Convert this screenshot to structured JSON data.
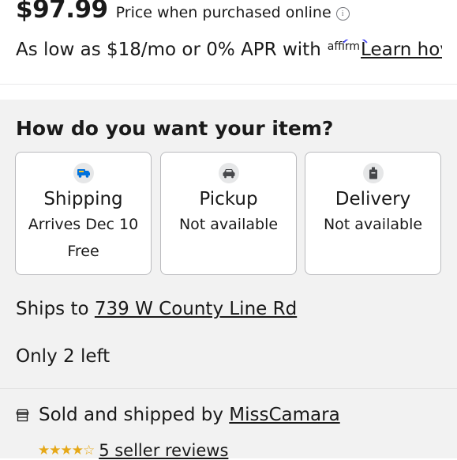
{
  "product": {
    "price": "$97.99",
    "price_note": "Price when purchased online",
    "info_glyph": "i"
  },
  "financing": {
    "text": "As low as $18/mo or 0% APR with",
    "brand": "affirm",
    "link": "Learn hov"
  },
  "fulfillment": {
    "question": "How do you want your item?",
    "options": [
      {
        "title": "Shipping",
        "subtitle": "Arrives Dec 10",
        "extra": "Free",
        "icon": "shipping-truck-icon"
      },
      {
        "title": "Pickup",
        "subtitle": "Not available",
        "icon": "pickup-car-icon"
      },
      {
        "title": "Delivery",
        "subtitle": "Not available",
        "icon": "delivery-bag-icon"
      }
    ]
  },
  "shipping": {
    "ships_to_label": "Ships to",
    "address": "739 W County Line Rd"
  },
  "stock": {
    "text": "Only 2 left"
  },
  "seller": {
    "label": "Sold and shipped by",
    "name": "MissCamara",
    "rating": 3.5,
    "stars": "★★★★☆",
    "reviews": "5 seller reviews",
    "icon": "store-icon"
  },
  "colors": {
    "text": "#1a1a1a",
    "panel_bg": "#f2f2f2",
    "card_border": "#babbbe",
    "shipping_icon_blue": "#0071dc",
    "star": "#e6a817"
  }
}
